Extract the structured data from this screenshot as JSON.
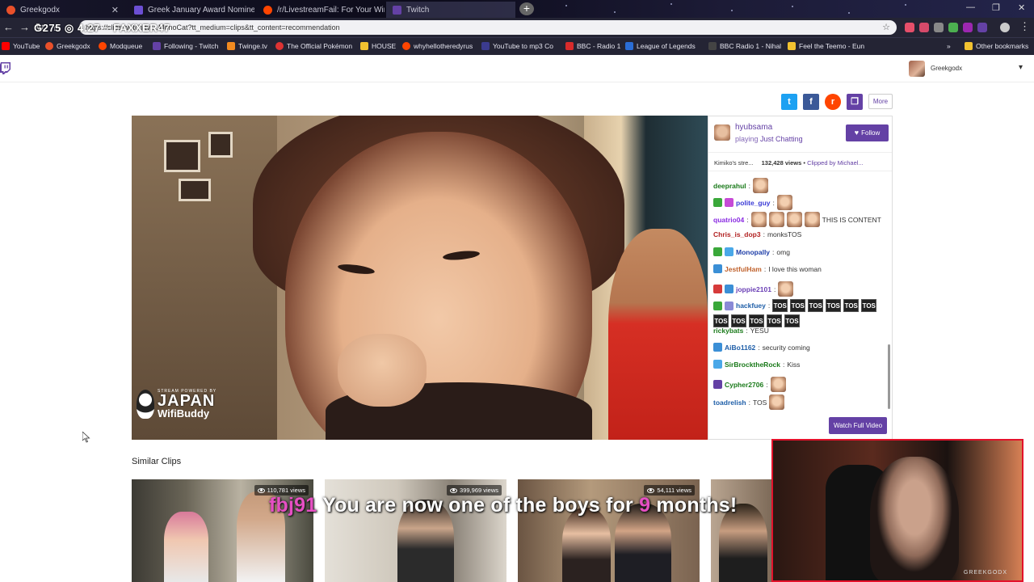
{
  "browser": {
    "tabs": [
      {
        "title": "Greekgodx",
        "favicon_color": "#e9502a"
      },
      {
        "title": "Greek January Award Nominees",
        "favicon_color": "#6c4fd4"
      },
      {
        "title": "/r/LivestreamFail: For Your Win...",
        "favicon_color": "#ff4500"
      },
      {
        "title": "Twitch",
        "favicon_color": "#6441a5"
      }
    ],
    "new_tab": "+",
    "url": "https://clips.twitch.tv/...MonoCat?tt_medium=clips&tt_content=recommendation",
    "overlay_text": "G275 ◎ 4:27 ~ FAXXER47",
    "bookmarks": [
      {
        "label": "YouTube",
        "color": "#ff0000"
      },
      {
        "label": "Greekgodx",
        "color": "#e9502a"
      },
      {
        "label": "Modqueue",
        "color": "#ff4500"
      },
      {
        "label": "Following - Twitch",
        "color": "#6441a5"
      },
      {
        "label": "Twinge.tv",
        "color": "#f28b20"
      },
      {
        "label": "The Official Pokémon",
        "color": "#d33"
      },
      {
        "label": "HOUSE",
        "color": "#f2c230"
      },
      {
        "label": "whyhellotheredyrus",
        "color": "#ff4500"
      },
      {
        "label": "YouTube to mp3 Co",
        "color": "#3b3b8f"
      },
      {
        "label": "BBC - Radio 1",
        "color": "#d82b2b"
      },
      {
        "label": "League of Legends",
        "color": "#2a6dd6"
      },
      {
        "label": "BBC Radio 1 - Nihal",
        "color": "#444"
      },
      {
        "label": "Feel the Teemo - Eun",
        "color": "#f2c230"
      }
    ],
    "more_bookmarks": "»",
    "other_bookmarks": "Other bookmarks"
  },
  "header": {
    "username": "Greekgodx",
    "chevron": "▾"
  },
  "share": {
    "twitter": "t",
    "facebook": "f",
    "reddit": "r",
    "copy": "❐",
    "more": "More"
  },
  "video": {
    "watermark_small": "STREAM POWERED BY",
    "watermark_big": "JAPAN",
    "watermark_sub": "WifiBuddy"
  },
  "panel": {
    "channel_name": "hyubsama",
    "playing_label": "playing",
    "game": "Just Chatting",
    "follow_label": "Follow",
    "clip_title": "Kimiko's stre...",
    "views": "132,428 views",
    "clipped_by": "Clipped by Michael...",
    "watch_full_label": "Watch Full Video"
  },
  "chat": [
    {
      "user": "deeprahul",
      "color": "#1a7a1a",
      "text": "",
      "emotes": 1,
      "tos": 0,
      "badges": []
    },
    {
      "user": "polite_guy",
      "color": "#3a3ad6",
      "text": "",
      "emotes": 1,
      "tos": 0,
      "badges": [
        "#3aa83a",
        "#c64ad6"
      ]
    },
    {
      "user": "quatrio04",
      "color": "#8a2be2",
      "text": "THIS IS CONTENT",
      "emotes": 4,
      "tos": 0,
      "badges": []
    },
    {
      "user": "Chris_is_dop3",
      "color": "#b22222",
      "text": "monksTOS",
      "emotes": 0,
      "tos": 0,
      "badges": []
    },
    {
      "user": "Monopally",
      "color": "#1e3ea8",
      "text": "omg",
      "emotes": 0,
      "tos": 0,
      "badges": [
        "#3aa83a",
        "#4aa8e8"
      ]
    },
    {
      "user": "JestfulHam",
      "color": "#c0622d",
      "text": "I love this woman",
      "emotes": 0,
      "tos": 0,
      "badges": [
        "#3b8fd6"
      ]
    },
    {
      "user": "joppie2101",
      "color": "#6a3fb5",
      "text": "",
      "emotes": 1,
      "tos": 0,
      "badges": [
        "#d63a3a",
        "#3b8fd6"
      ]
    },
    {
      "user": "hackfuey",
      "color": "#1e5ea8",
      "text": "",
      "emotes": 0,
      "tos": 11,
      "badges": [
        "#3aa83a",
        "#8a8ad6"
      ]
    },
    {
      "user": "rickybats",
      "color": "#1a7a1a",
      "text": "YESU",
      "emotes": 0,
      "tos": 0,
      "badges": []
    },
    {
      "user": "AiBo1162",
      "color": "#1e5ea8",
      "text": "security coming",
      "emotes": 0,
      "tos": 0,
      "badges": [
        "#3b8fd6"
      ]
    },
    {
      "user": "SirBrocktheRock",
      "color": "#1a7a1a",
      "text": "Kiss",
      "emotes": 0,
      "tos": 0,
      "badges": [
        "#4aa8e8"
      ]
    },
    {
      "user": "Cypher2706",
      "color": "#1a7a1a",
      "text": "",
      "emotes": 1,
      "tos": 0,
      "badges": [
        "#6441a5"
      ]
    },
    {
      "user": "toadrelish",
      "color": "#1e5ea8",
      "text": "TOS",
      "emotes": 1,
      "tos": 0,
      "badges": []
    }
  ],
  "tos_label": "TOS",
  "similar": {
    "title": "Similar Clips",
    "clips": [
      {
        "views": "110,781 views"
      },
      {
        "views": "399,969 views"
      },
      {
        "views": "54,111 views"
      },
      {
        "views": ""
      }
    ]
  },
  "alert": {
    "username": "fbj91",
    "before": "You are now one of the boys for",
    "months": "9",
    "after": "months!"
  },
  "webcam": {
    "label": "GREEKGODX"
  }
}
